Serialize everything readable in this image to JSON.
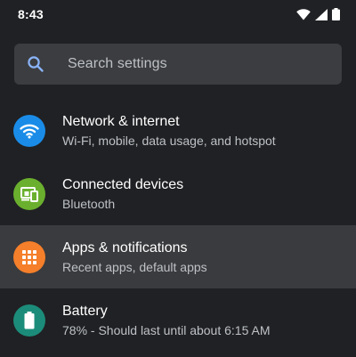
{
  "status_bar": {
    "time": "8:43",
    "icons": [
      "wifi-icon",
      "cellular-signal-icon",
      "battery-icon"
    ]
  },
  "search": {
    "placeholder": "Search settings",
    "icon": "search-icon",
    "icon_color": "#8ab4f8"
  },
  "items": [
    {
      "title": "Network & internet",
      "subtitle": "Wi-Fi, mobile, data usage, and hotspot",
      "icon": "wifi-icon",
      "icon_color": "#1a8ce8"
    },
    {
      "title": "Connected devices",
      "subtitle": "Bluetooth",
      "icon": "connected-devices-icon",
      "icon_color": "#6ab02e"
    },
    {
      "title": "Apps & notifications",
      "subtitle": "Recent apps, default apps",
      "icon": "apps-grid-icon",
      "icon_color": "#f57f2a",
      "highlighted": true
    },
    {
      "title": "Battery",
      "subtitle": "78% - Should last until about 6:15 AM",
      "icon": "battery-icon",
      "icon_color": "#1c8c7a"
    }
  ],
  "colors": {
    "background": "#202124",
    "search_background": "#3c3d40",
    "highlight_background": "#3a3b3e"
  }
}
